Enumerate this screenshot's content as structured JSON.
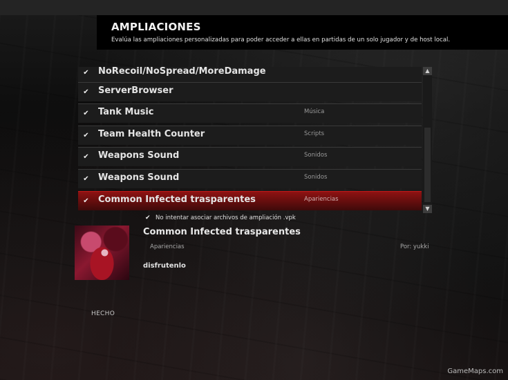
{
  "header": {
    "title": "AMPLIACIONES",
    "subtitle": "Evalúa las ampliaciones personalizadas para poder acceder a ellas en partidas de un solo jugador y de host local."
  },
  "addons": [
    {
      "name": "NoRecoil/NoSpread/MoreDamage",
      "category": "",
      "checked": true,
      "selected": false
    },
    {
      "name": "ServerBrowser",
      "category": "",
      "checked": true,
      "selected": false
    },
    {
      "name": "Tank Music",
      "category": "Música",
      "checked": true,
      "selected": false
    },
    {
      "name": "Team Health Counter",
      "category": "Scripts",
      "checked": true,
      "selected": false
    },
    {
      "name": "Weapons Sound",
      "category": "Sonidos",
      "checked": true,
      "selected": false
    },
    {
      "name": "Weapons Sound",
      "category": "Sonidos",
      "checked": true,
      "selected": false
    },
    {
      "name": "Common Infected trasparentes",
      "category": "Apariencias",
      "checked": true,
      "selected": true
    }
  ],
  "check_glyph": "✔",
  "scroll": {
    "up_glyph": "▲",
    "down_glyph": "▼"
  },
  "vpk_option": {
    "label": "No intentar asociar archivos de ampliación .vpk",
    "checked": true
  },
  "details": {
    "name": "Common Infected trasparentes",
    "category": "Apariencias",
    "author": "Por: yukki",
    "description": "disfrutenlo"
  },
  "done_label": "HECHO",
  "watermark": "GameMaps.com",
  "colors": {
    "selection": "#8e1212",
    "row_bg": "#1c1c1c"
  }
}
